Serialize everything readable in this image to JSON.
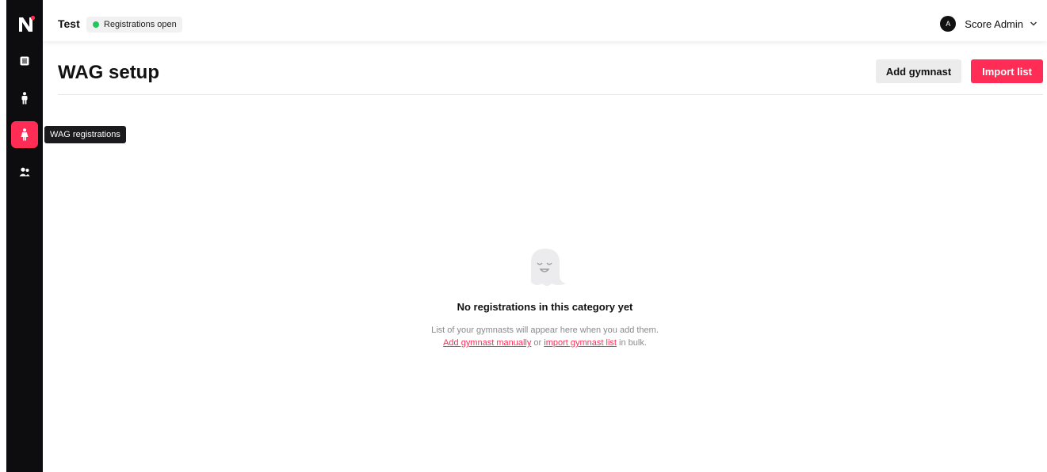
{
  "header": {
    "event_title": "Test",
    "status_label": "Registrations open",
    "user": {
      "initial": "A",
      "name": "Score Admin"
    }
  },
  "sidebar": {
    "tooltip": "WAG registrations",
    "items": [
      {
        "id": "overview",
        "icon": "list-icon"
      },
      {
        "id": "mag",
        "icon": "male-figure-icon"
      },
      {
        "id": "wag",
        "icon": "female-figure-icon",
        "active": true
      },
      {
        "id": "teams",
        "icon": "group-icon"
      }
    ]
  },
  "main": {
    "title": "WAG setup",
    "add_button": "Add gymnast",
    "import_button": "Import list"
  },
  "empty_state": {
    "title": "No registrations in this category yet",
    "description": "List of your gymnasts will appear here when you add them.",
    "link_manual": "Add gymnast manually",
    "or_text": " or ",
    "link_import": "import gymnast list",
    "suffix": " in bulk."
  },
  "colors": {
    "accent": "#ff2d55",
    "sidebar_bg": "#0d0d0f",
    "status_dot": "#22c55e"
  }
}
